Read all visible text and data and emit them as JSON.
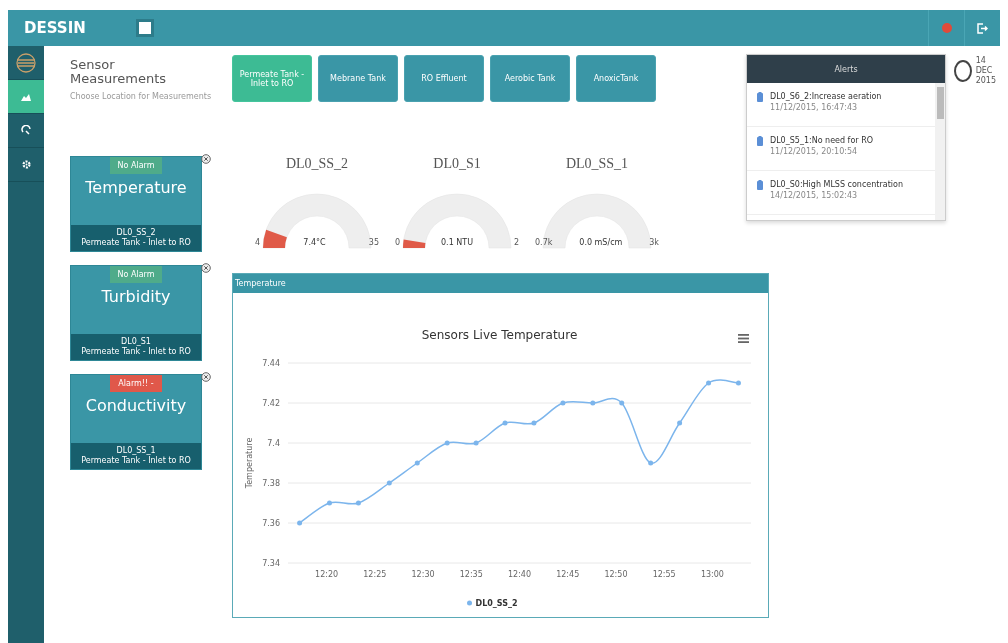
{
  "topbar": {
    "brand": "DESSIN",
    "alert_active": true
  },
  "sidebar": {
    "items": [
      {
        "selected": false
      },
      {
        "selected": true
      },
      {
        "selected": false
      },
      {
        "selected": false
      }
    ]
  },
  "header": {
    "title": "Sensor Measurements",
    "subtitle": "Choose Location for Measurements"
  },
  "locations": [
    {
      "label": "Permeate Tank - Inlet to RO",
      "selected": true
    },
    {
      "label": "Mebrane Tank",
      "selected": false
    },
    {
      "label": "RO Effluent",
      "selected": false
    },
    {
      "label": "Aerobic Tank",
      "selected": false
    },
    {
      "label": "AnoxicTank",
      "selected": false
    }
  ],
  "date": {
    "day": "14",
    "month": "DEC",
    "year": "2015"
  },
  "alerts": {
    "title": "Alerts",
    "items": [
      {
        "text": "DL0_S6_2:Increase aeration",
        "time": "11/12/2015, 16:47:43"
      },
      {
        "text": "DL0_S5_1:No need for RO",
        "time": "11/12/2015, 20:10:54"
      },
      {
        "text": "DL0_S0:High MLSS concentration",
        "time": "14/12/2015, 15:02:43"
      }
    ]
  },
  "sensors": [
    {
      "alarm": false,
      "status": "No Alarm",
      "name": "Temperature",
      "id": "DL0_SS_2",
      "location": "Permeate Tank - Inlet to RO"
    },
    {
      "alarm": false,
      "status": "No Alarm",
      "name": "Turbidity",
      "id": "DL0_S1",
      "location": "Permeate Tank - Inlet to RO"
    },
    {
      "alarm": true,
      "status": "Alarm!! -",
      "name": "Conductivity",
      "id": "DL0_SS_1",
      "location": "Permeate Tank - Inlet to RO"
    }
  ],
  "gauges": [
    {
      "title": "DL0_SS_2",
      "min": "4",
      "reading": "7.4°C",
      "max": "35"
    },
    {
      "title": "DL0_S1",
      "min": "0",
      "reading": "0.1 NTU",
      "max": "2"
    },
    {
      "title": "DL0_SS_1",
      "min": "0.7k",
      "reading": "0.0 mS/cm",
      "max": "3k"
    }
  ],
  "chart_panel": {
    "title": "Temperature",
    "chart_data": {
      "type": "line",
      "grid": true,
      "title": "Sensors Live Temperature",
      "ylabel": "Temperature",
      "x": [
        737.2,
        740.3,
        743.3,
        746.5,
        749.4,
        752.5,
        755.5,
        758.5,
        761.5,
        764.5,
        767.6,
        770.6,
        773.6,
        776.6,
        779.6,
        782.7
      ],
      "series": [
        {
          "name": "DL0_SS_2",
          "color": "#7cb5ec",
          "values": [
            7.36,
            7.37,
            7.37,
            7.38,
            7.39,
            7.4,
            7.4,
            7.41,
            7.41,
            7.42,
            7.42,
            7.42,
            7.39,
            7.41,
            7.43,
            7.43
          ]
        }
      ],
      "xlim": [
        736,
        784
      ],
      "ylim": [
        7.34,
        7.44
      ],
      "xticks": [
        {
          "value": 740,
          "label": "12:20"
        },
        {
          "value": 745,
          "label": "12:25"
        },
        {
          "value": 750,
          "label": "12:30"
        },
        {
          "value": 755,
          "label": "12:35"
        },
        {
          "value": 760,
          "label": "12:40"
        },
        {
          "value": 765,
          "label": "12:45"
        },
        {
          "value": 770,
          "label": "12:50"
        },
        {
          "value": 775,
          "label": "12:55"
        },
        {
          "value": 780,
          "label": "13:00"
        }
      ],
      "yticks": [
        7.34,
        {
          "value": 7.36,
          "label": "7.36"
        },
        {
          "value": 7.38,
          "label": "7.38"
        },
        {
          "value": 7.4,
          "label": "7.4"
        },
        {
          "value": 7.42,
          "label": "7.42"
        },
        {
          "value": 7.44,
          "label": "7.44"
        }
      ]
    }
  }
}
